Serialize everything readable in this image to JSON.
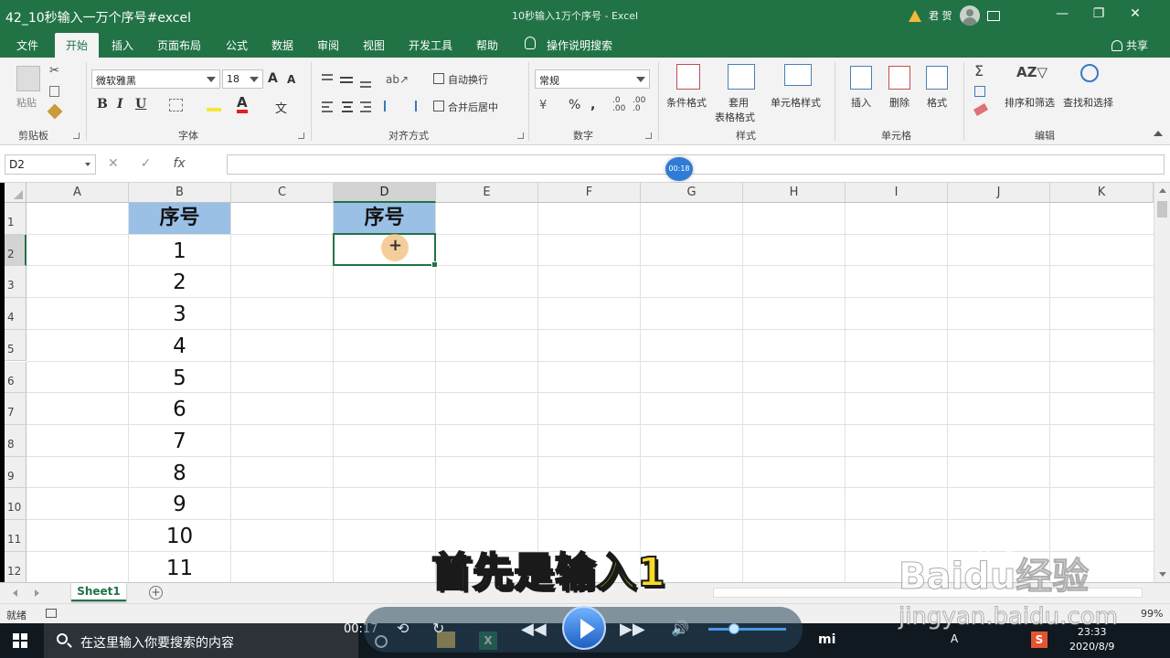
{
  "video": {
    "title": "42_10秒输入一万个序号#excel",
    "current_time": "00:17",
    "badge_time": "00:18"
  },
  "window": {
    "title": "10秒输入1万个序号 - Excel",
    "user": "君 贺",
    "controls": [
      "ribbon-options-icon",
      "minimize-icon",
      "restore-icon",
      "close-icon"
    ]
  },
  "menu": {
    "items": [
      "文件",
      "开始",
      "插入",
      "页面布局",
      "公式",
      "数据",
      "审阅",
      "视图",
      "开发工具",
      "帮助"
    ],
    "active": "开始",
    "tell_me": "操作说明搜索",
    "share": "共享"
  },
  "ribbon": {
    "clipboard": {
      "label": "剪贴板",
      "paste": "粘贴"
    },
    "font": {
      "label": "字体",
      "name": "微软雅黑",
      "size": "18",
      "bold": "B",
      "italic": "I",
      "underline": "U",
      "grow": "A",
      "shrink": "A",
      "phonetic": "文"
    },
    "alignment": {
      "label": "对齐方式",
      "wrap": "自动换行",
      "merge": "合并后居中"
    },
    "number": {
      "label": "数字",
      "format": "常规"
    },
    "styles": {
      "label": "样式",
      "conditional": "条件格式",
      "table_l1": "套用",
      "table_l2": "表格格式",
      "cell_styles": "单元格样式"
    },
    "cells": {
      "label": "单元格",
      "insert": "插入",
      "delete": "删除",
      "format": "格式"
    },
    "editing": {
      "label": "编辑",
      "sort": "排序和筛选",
      "find": "查找和选择"
    }
  },
  "formula_bar": {
    "name_box": "D2",
    "cancel": "✕",
    "enter": "✓",
    "fx": "fx",
    "value": ""
  },
  "sheet": {
    "columns": [
      "A",
      "B",
      "C",
      "D",
      "E",
      "F",
      "G",
      "H",
      "I",
      "J",
      "K"
    ],
    "rows": [
      "1",
      "2",
      "3",
      "4",
      "5",
      "6",
      "7",
      "8",
      "9",
      "10",
      "11",
      "12"
    ],
    "selected_cell": "D2",
    "header_fill": "#9ac0e6",
    "cells": {
      "B1": "序号",
      "D1": "序号",
      "B": [
        "1",
        "2",
        "3",
        "4",
        "5",
        "6",
        "7",
        "8",
        "9",
        "10",
        "11"
      ]
    },
    "tab": "Sheet1"
  },
  "status": {
    "ready": "就绪",
    "zoom": "99%"
  },
  "taskbar": {
    "search_placeholder": "在这里输入你要搜索的内容",
    "clock_time": "23:33",
    "clock_date": "2020/8/9",
    "ime": "A"
  },
  "overlay": {
    "subtitle": "首先是输入1",
    "watermark_logo": "Baidu经验",
    "watermark_url": "jingyan.baidu.com"
  },
  "colors": {
    "excel_green": "#217346",
    "subtitle_yellow": "#f8dc24",
    "selection_border": "#217346"
  }
}
